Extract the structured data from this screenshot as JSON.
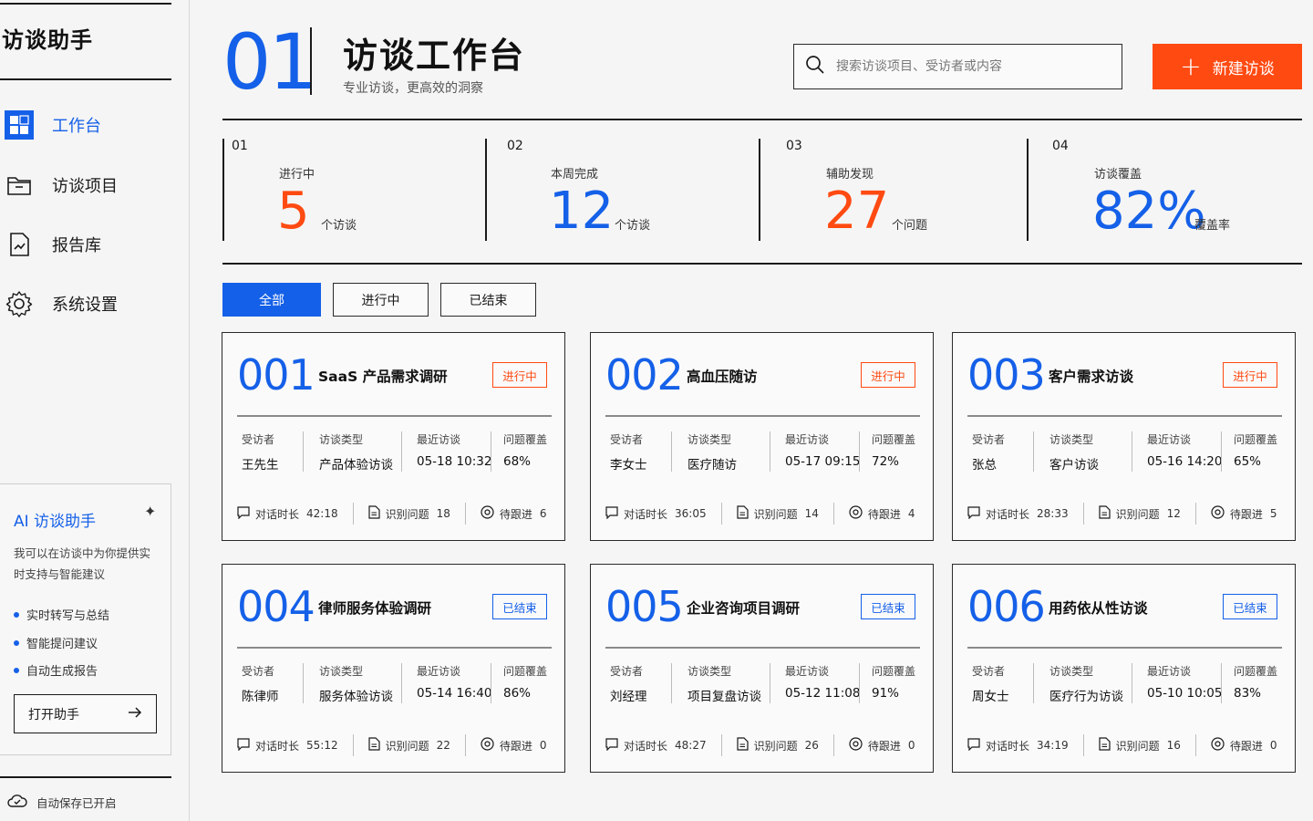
{
  "app": {
    "name": "访谈助手"
  },
  "sidebar": {
    "items": [
      {
        "label": "工作台",
        "icon": "dashboard-icon",
        "active": true
      },
      {
        "label": "访谈项目",
        "icon": "folder-icon",
        "active": false
      },
      {
        "label": "报告库",
        "icon": "report-icon",
        "active": false
      },
      {
        "label": "系统设置",
        "icon": "gear-icon",
        "active": false
      }
    ],
    "ai_card": {
      "title": "AI 访谈助手",
      "description": "我可以在访谈中为你提供实时支持与智能建议",
      "features": [
        "实时转写与总结",
        "智能提问建议",
        "自动生成报告"
      ],
      "button_label": "打开助手"
    },
    "autosave": "自动保存已开启"
  },
  "header": {
    "number": "01",
    "title": "访谈工作台",
    "subtitle": "专业访谈，更高效的洞察",
    "search_placeholder": "搜索访谈项目、受访者或内容",
    "new_button": "新建访谈"
  },
  "stats": [
    {
      "index": "01",
      "label": "进行中",
      "value": "5",
      "unit": "个访谈",
      "color": "#ff4a12"
    },
    {
      "index": "02",
      "label": "本周完成",
      "value": "12",
      "unit": "个访谈",
      "color": "#1560e8"
    },
    {
      "index": "03",
      "label": "辅助发现",
      "value": "27",
      "unit": "个问题",
      "color": "#ff4a12"
    },
    {
      "index": "04",
      "label": "访谈覆盖",
      "value": "82%",
      "unit": "覆盖率",
      "color": "#1560e8"
    }
  ],
  "filters": [
    {
      "label": "全部",
      "active": true
    },
    {
      "label": "进行中",
      "active": false
    },
    {
      "label": "已结束",
      "active": false
    }
  ],
  "card_labels": {
    "interviewee": "受访者",
    "type": "访谈类型",
    "recent": "最近访谈",
    "coverage": "问题覆盖",
    "duration": "对话时长",
    "issues": "识别问题",
    "followups": "待跟进"
  },
  "projects": [
    {
      "number": "001",
      "title": "SaaS 产品需求调研",
      "status": "进行中",
      "interviewee": "王先生",
      "type": "产品体验访谈",
      "recent": "05-18 10:32",
      "coverage": "68%",
      "duration": "42:18",
      "issues": "18",
      "followups": "6"
    },
    {
      "number": "002",
      "title": "高血压随访",
      "status": "进行中",
      "interviewee": "李女士",
      "type": "医疗随访",
      "recent": "05-17 09:15",
      "coverage": "72%",
      "duration": "36:05",
      "issues": "14",
      "followups": "4"
    },
    {
      "number": "003",
      "title": "客户需求访谈",
      "status": "进行中",
      "interviewee": "张总",
      "type": "客户访谈",
      "recent": "05-16 14:20",
      "coverage": "65%",
      "duration": "28:33",
      "issues": "12",
      "followups": "5"
    },
    {
      "number": "004",
      "title": "律师服务体验调研",
      "status": "已结束",
      "interviewee": "陈律师",
      "type": "服务体验访谈",
      "recent": "05-14 16:40",
      "coverage": "86%",
      "duration": "55:12",
      "issues": "22",
      "followups": "0"
    },
    {
      "number": "005",
      "title": "企业咨询项目调研",
      "status": "已结束",
      "interviewee": "刘经理",
      "type": "项目复盘访谈",
      "recent": "05-12 11:08",
      "coverage": "91%",
      "duration": "48:27",
      "issues": "26",
      "followups": "0"
    },
    {
      "number": "006",
      "title": "用药依从性访谈",
      "status": "已结束",
      "interviewee": "周女士",
      "type": "医疗行为访谈",
      "recent": "05-10 10:05",
      "coverage": "83%",
      "duration": "34:19",
      "issues": "16",
      "followups": "0"
    }
  ],
  "colors": {
    "accent": "#1560e8",
    "brand_orange": "#ff4a12",
    "text": "#1a1a1a"
  }
}
